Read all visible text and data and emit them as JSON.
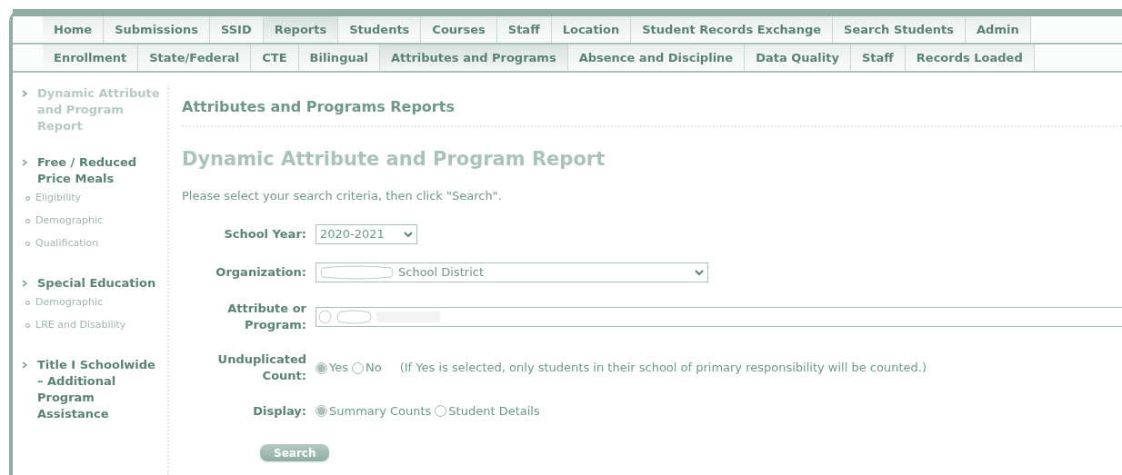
{
  "nav_primary": [
    {
      "label": "Home",
      "selected": false
    },
    {
      "label": "Submissions",
      "selected": false
    },
    {
      "label": "SSID",
      "selected": false
    },
    {
      "label": "Reports",
      "selected": true
    },
    {
      "label": "Students",
      "selected": false
    },
    {
      "label": "Courses",
      "selected": false
    },
    {
      "label": "Staff",
      "selected": false
    },
    {
      "label": "Location",
      "selected": false
    },
    {
      "label": "Student Records Exchange",
      "selected": false
    },
    {
      "label": "Search Students",
      "selected": false
    },
    {
      "label": "Admin",
      "selected": false
    }
  ],
  "nav_secondary": [
    {
      "label": "Enrollment",
      "selected": false
    },
    {
      "label": "State/Federal",
      "selected": false
    },
    {
      "label": "CTE",
      "selected": false
    },
    {
      "label": "Bilingual",
      "selected": false
    },
    {
      "label": "Attributes and Programs",
      "selected": true
    },
    {
      "label": "Absence and Discipline",
      "selected": false
    },
    {
      "label": "Data Quality",
      "selected": false
    },
    {
      "label": "Staff",
      "selected": false
    },
    {
      "label": "Records Loaded",
      "selected": false
    }
  ],
  "sidebar": {
    "sections": [
      {
        "label": "Dynamic Attribute and Program Report",
        "selected": true
      },
      {
        "label": "Free / Reduced Price Meals",
        "selected": false,
        "children": [
          {
            "label": "Eligibility"
          },
          {
            "label": "Demographic"
          },
          {
            "label": "Qualification"
          }
        ]
      },
      {
        "label": "Special Education",
        "selected": false,
        "children": [
          {
            "label": "Demographic"
          },
          {
            "label": "LRE and Disability"
          }
        ]
      },
      {
        "label": "Title I Schoolwide – Additional Program Assistance",
        "selected": false
      }
    ]
  },
  "content": {
    "section_title": "Attributes and Programs Reports",
    "page_title": "Dynamic Attribute and Program Report",
    "instructions": "Please select your search criteria, then click \"Search\".",
    "form": [
      {
        "kind": "select",
        "label": "School Year:",
        "value": "2020-2021"
      },
      {
        "kind": "longselect",
        "label": "Organization:",
        "value": "School District",
        "redacted": true
      },
      {
        "kind": "text",
        "label": "Attribute or Program:",
        "redacted": true
      },
      {
        "kind": "radio",
        "label": "Unduplicated Count:",
        "options": [
          {
            "label": "Yes",
            "selected": true
          },
          {
            "label": "No",
            "selected": false
          }
        ],
        "note": "(If Yes is selected, only students in their school of primary responsibility will be counted.)"
      },
      {
        "kind": "radio",
        "label": "Display:",
        "options": [
          {
            "label": "Summary Counts",
            "selected": true
          },
          {
            "label": "Student Details",
            "selected": false
          }
        ]
      }
    ],
    "search_button": "Search"
  }
}
